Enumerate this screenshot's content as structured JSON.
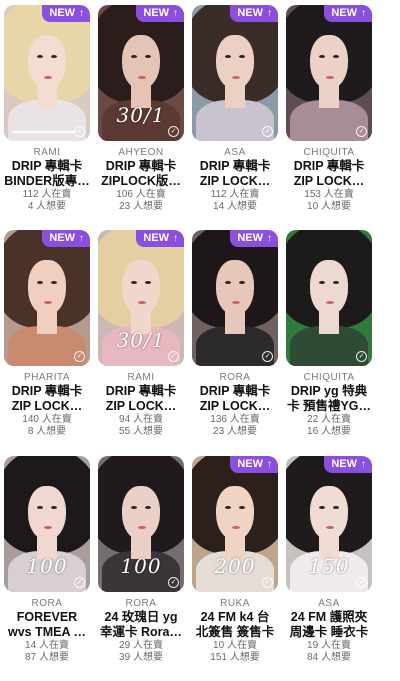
{
  "badge_label": "NEW",
  "badge_icon": "arrow-up-icon",
  "accent_color": "#8b4fe0",
  "cards": [
    {
      "member": "RAMI",
      "title1": "DRIP 專輯卡",
      "title2": "BINDER版專…",
      "selling": "112 人在賣",
      "wanting": "4 人想要",
      "new": true,
      "handwritten": "",
      "progress": true
    },
    {
      "member": "AHYEON",
      "title1": "DRIP 專輯卡",
      "title2": "ZIPLOCK版…",
      "selling": "106 人在賣",
      "wanting": "23 人想要",
      "new": true,
      "handwritten": "30/1",
      "progress": false
    },
    {
      "member": "ASA",
      "title1": "DRIP 專輯卡",
      "title2": "ZIP LOCK…",
      "selling": "112 人在賣",
      "wanting": "14 人想要",
      "new": true,
      "handwritten": "",
      "progress": false
    },
    {
      "member": "CHIQUITA",
      "title1": "DRIP 專輯卡",
      "title2": "ZIP LOCK…",
      "selling": "153 人在賣",
      "wanting": "10 人想要",
      "new": true,
      "handwritten": "",
      "progress": false
    },
    {
      "member": "PHARITA",
      "title1": "DRIP 專輯卡",
      "title2": "ZIP LOCK…",
      "selling": "140 人在賣",
      "wanting": "8 人想要",
      "new": true,
      "handwritten": "",
      "progress": false
    },
    {
      "member": "RAMI",
      "title1": "DRIP 專輯卡",
      "title2": "ZIP LOCK…",
      "selling": "94 人在賣",
      "wanting": "55 人想要",
      "new": true,
      "handwritten": "30/1",
      "progress": false
    },
    {
      "member": "RORA",
      "title1": "DRIP 專輯卡",
      "title2": "ZIP LOCK…",
      "selling": "136 人在賣",
      "wanting": "23 人想要",
      "new": true,
      "handwritten": "",
      "progress": false
    },
    {
      "member": "CHIQUITA",
      "title1": "DRIP yg 特典",
      "title2": "卡 預售禮YG…",
      "selling": "22 人在賣",
      "wanting": "16 人想要",
      "new": false,
      "handwritten": "",
      "progress": false
    },
    {
      "member": "RORA",
      "title1": "FOREVER",
      "title2": "wvs TMEA …",
      "selling": "14 人在賣",
      "wanting": "87 人想要",
      "new": false,
      "handwritten": "100",
      "progress": false
    },
    {
      "member": "RORA",
      "title1": "24 玫瑰日 yg",
      "title2": "幸運卡 Rora…",
      "selling": "29 人在賣",
      "wanting": "39 人想要",
      "new": false,
      "handwritten": "100",
      "progress": false
    },
    {
      "member": "RUKA",
      "title1": "24 FM k4 台",
      "title2": "北簽售 簽售卡",
      "selling": "10 人在賣",
      "wanting": "151 人想要",
      "new": true,
      "handwritten": "200",
      "progress": false
    },
    {
      "member": "ASA",
      "title1": "24 FM 護照夾",
      "title2": "周邊卡 睡衣卡",
      "selling": "19 人在賣",
      "wanting": "84 人想要",
      "new": true,
      "handwritten": "150",
      "progress": false
    }
  ]
}
